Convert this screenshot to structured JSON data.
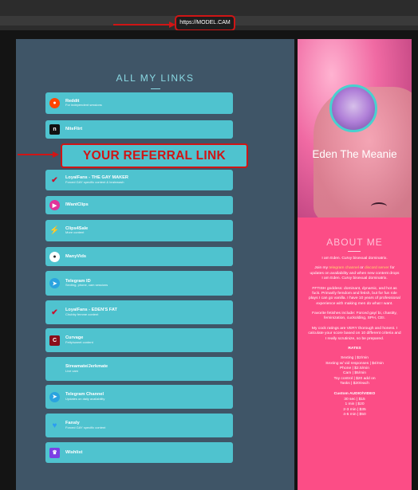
{
  "browser": {
    "url": "https://MODEL.CAM"
  },
  "links_section": {
    "title": "ALL MY LINKS",
    "referral_label": "YOUR REFERRAL LINK",
    "links": [
      {
        "title": "Reddit",
        "subtitle": "For independent sessions",
        "icon": "reddit-icon",
        "color": "#ff4500"
      },
      {
        "title": "NiteFlirt",
        "subtitle": "",
        "icon": "niteflirt-icon",
        "color": "#111111"
      },
      {
        "title": "LoyalFans - THE GAY MAKER",
        "subtitle": "Forced GAY specific content & brainwash",
        "icon": "loyalfans-icon",
        "color": "#c8102e"
      },
      {
        "title": "IWantClips",
        "subtitle": "",
        "icon": "iwantclips-icon",
        "color": "#e0349a"
      },
      {
        "title": "Clips4Sale",
        "subtitle": "More content",
        "icon": "clips4sale-icon",
        "color": "#7a8aa0"
      },
      {
        "title": "ManyVids",
        "subtitle": "",
        "icon": "manyvids-icon",
        "color": "#2b2b2b"
      },
      {
        "title": "Telegram ID",
        "subtitle": "Sexting, phone, cam sessions",
        "icon": "telegram-icon",
        "color": "#2aa3df"
      },
      {
        "title": "LoyalFans - EDEN'S FAT",
        "subtitle": "Chubby femme content",
        "icon": "loyalfans-icon",
        "color": "#c8102e"
      },
      {
        "title": "Curvage",
        "subtitle": "Fetty/sweet content",
        "icon": "curvage-icon",
        "color": "#8b0d1a"
      },
      {
        "title": "Streamate/Jerkmate",
        "subtitle": "Live cam",
        "icon": "",
        "color": ""
      },
      {
        "title": "Telegram Channel",
        "subtitle": "Updates on daily availability",
        "icon": "telegram-icon",
        "color": "#2aa3df"
      },
      {
        "title": "Fansly",
        "subtitle": "Forced GAY specific content",
        "icon": "fansly-icon",
        "color": "#2b9cf2"
      },
      {
        "title": "Wishlist",
        "subtitle": "",
        "icon": "wishlist-icon",
        "color": "#7b3fe4"
      }
    ]
  },
  "profile": {
    "name": "Eden The Meanie",
    "about_title": "ABOUT ME",
    "intro": "I am Eden. Curvy bisexual dominatrix.",
    "join_prefix": "Join my",
    "join_link1": "telegram channel",
    "join_or": "or",
    "join_link2": "discord server",
    "join_suffix": "for updates on availability and when new content drops",
    "intro2": "I am Eden. Curvy bisexual dominatrix.",
    "bio": "FFTISH goddess: dominant, dynamic, and hot as fuck. Primarily femdom and fetish, but for fun role plays I can go vanilla. I have 10 years of professional experience with making men do what I want.",
    "fetishes": "Favorite fetishes include: Forced gay/ bi, chastity, feminization, cuckolding, SPH, CEI.",
    "cock_ratings": "My cock ratings are VERY thorough and honest. I calculate your score based on 10 different criteria and I really scrutinize, so be prepared.",
    "rates_title": "RATES",
    "rates": [
      "Sexting | $2/min",
      "Sexting w/ vid responses | $4/min",
      "Phone | $2.5/min",
      "Cam | $5/min",
      "Toy control | $20 add on",
      "Tasks | $20/each"
    ],
    "custom_title": "Custom AUDIO/VIDEO",
    "custom_rates": [
      "30 sec | $15",
      "1 min | $20",
      "2-3 min | $35",
      "4-5 min | $50"
    ]
  }
}
